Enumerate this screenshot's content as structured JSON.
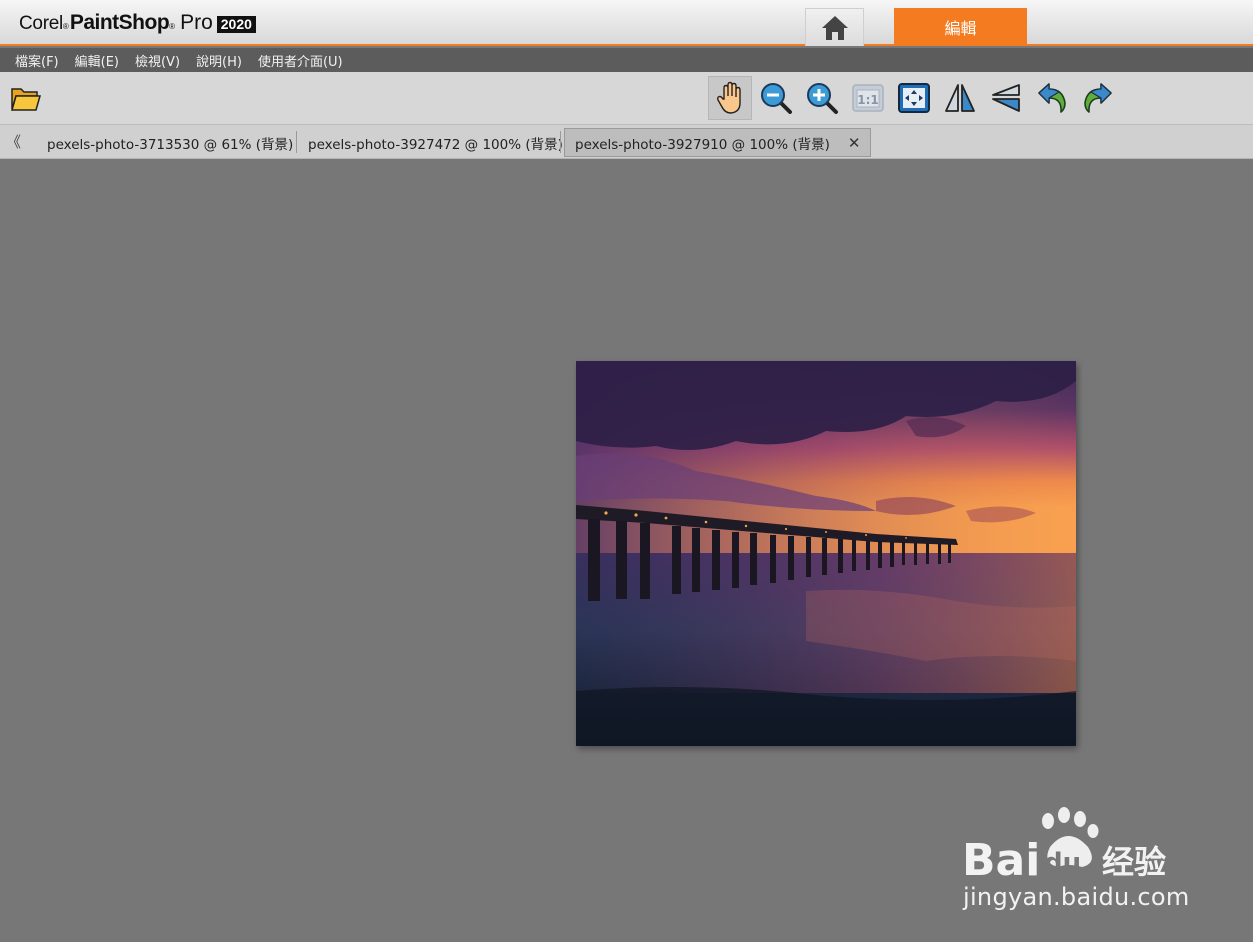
{
  "app": {
    "logo_corel": "Corel",
    "logo_paintshop": "PaintShop",
    "logo_pro": "Pro",
    "logo_year": "2020",
    "accent_color": "#f47b20"
  },
  "workspace_tabs": {
    "home_icon": "home-icon",
    "edit_label": "編輯"
  },
  "menu": {
    "items": [
      "檔案(F)",
      "編輯(E)",
      "檢視(V)",
      "說明(H)",
      "使用者介面(U)"
    ]
  },
  "toolbar": {
    "icons": [
      "open-folder-icon",
      "pan-hand-icon",
      "zoom-out-icon",
      "zoom-in-icon",
      "actual-size-icon",
      "fit-window-icon",
      "flip-icon",
      "mirror-icon",
      "undo-icon",
      "redo-icon"
    ],
    "actual_size_label": "1:1"
  },
  "document_tabs": {
    "scroll_left": "《",
    "tabs": [
      {
        "label": "pexels-photo-3713530 @  61% (背景)"
      },
      {
        "label": "pexels-photo-3927472 @ 100% (背景)"
      },
      {
        "label": "pexels-photo-3927910 @ 100% (背景)",
        "active": true,
        "close": "✕"
      }
    ]
  },
  "watermark": {
    "brand": "Baidu 经验",
    "url": "jingyan.baidu.com"
  }
}
